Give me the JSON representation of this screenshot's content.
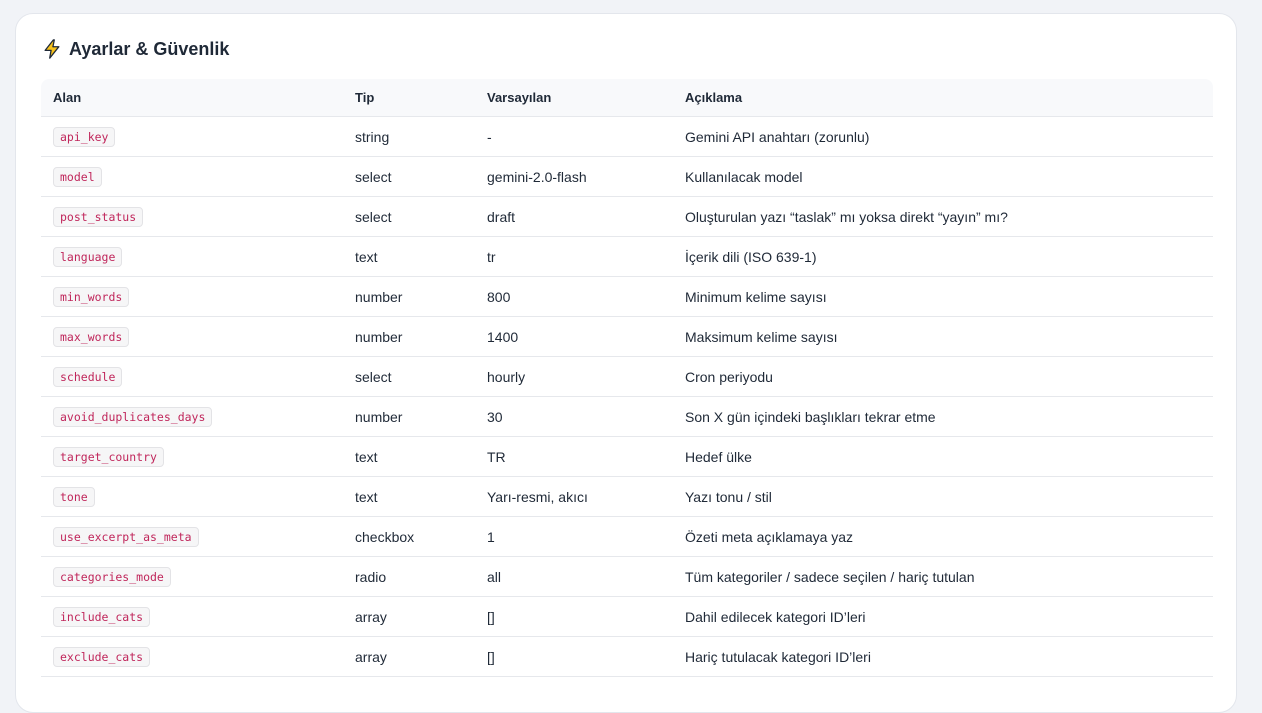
{
  "panel": {
    "title": "Ayarlar & Güvenlik",
    "icon": "lightning-bolt-icon",
    "icon_color": "#f5b50a"
  },
  "table": {
    "headers": [
      "Alan",
      "Tip",
      "Varsayılan",
      "Açıklama"
    ],
    "rows": [
      {
        "field": "api_key",
        "type": "string",
        "default": "-",
        "desc": "Gemini API anahtarı (zorunlu)"
      },
      {
        "field": "model",
        "type": "select",
        "default": "gemini-2.0-flash",
        "desc": "Kullanılacak model"
      },
      {
        "field": "post_status",
        "type": "select",
        "default": "draft",
        "desc": "Oluşturulan yazı “taslak” mı yoksa direkt “yayın” mı?"
      },
      {
        "field": "language",
        "type": "text",
        "default": "tr",
        "desc": "İçerik dili (ISO 639-1)"
      },
      {
        "field": "min_words",
        "type": "number",
        "default": "800",
        "desc": "Minimum kelime sayısı"
      },
      {
        "field": "max_words",
        "type": "number",
        "default": "1400",
        "desc": "Maksimum kelime sayısı"
      },
      {
        "field": "schedule",
        "type": "select",
        "default": "hourly",
        "desc": "Cron periyodu"
      },
      {
        "field": "avoid_duplicates_days",
        "type": "number",
        "default": "30",
        "desc": "Son X gün içindeki başlıkları tekrar etme"
      },
      {
        "field": "target_country",
        "type": "text",
        "default": "TR",
        "desc": "Hedef ülke"
      },
      {
        "field": "tone",
        "type": "text",
        "default": "Yarı-resmi, akıcı",
        "desc": "Yazı tonu / stil"
      },
      {
        "field": "use_excerpt_as_meta",
        "type": "checkbox",
        "default": "1",
        "desc": "Özeti meta açıklamaya yaz"
      },
      {
        "field": "categories_mode",
        "type": "radio",
        "default": "all",
        "desc": "Tüm kategoriler / sadece seçilen / hariç tutulan"
      },
      {
        "field": "include_cats",
        "type": "array",
        "default": "[]",
        "desc": "Dahil edilecek kategori ID’leri"
      },
      {
        "field": "exclude_cats",
        "type": "array",
        "default": "[]",
        "desc": "Hariç tutulacak kategori ID’leri"
      }
    ]
  }
}
